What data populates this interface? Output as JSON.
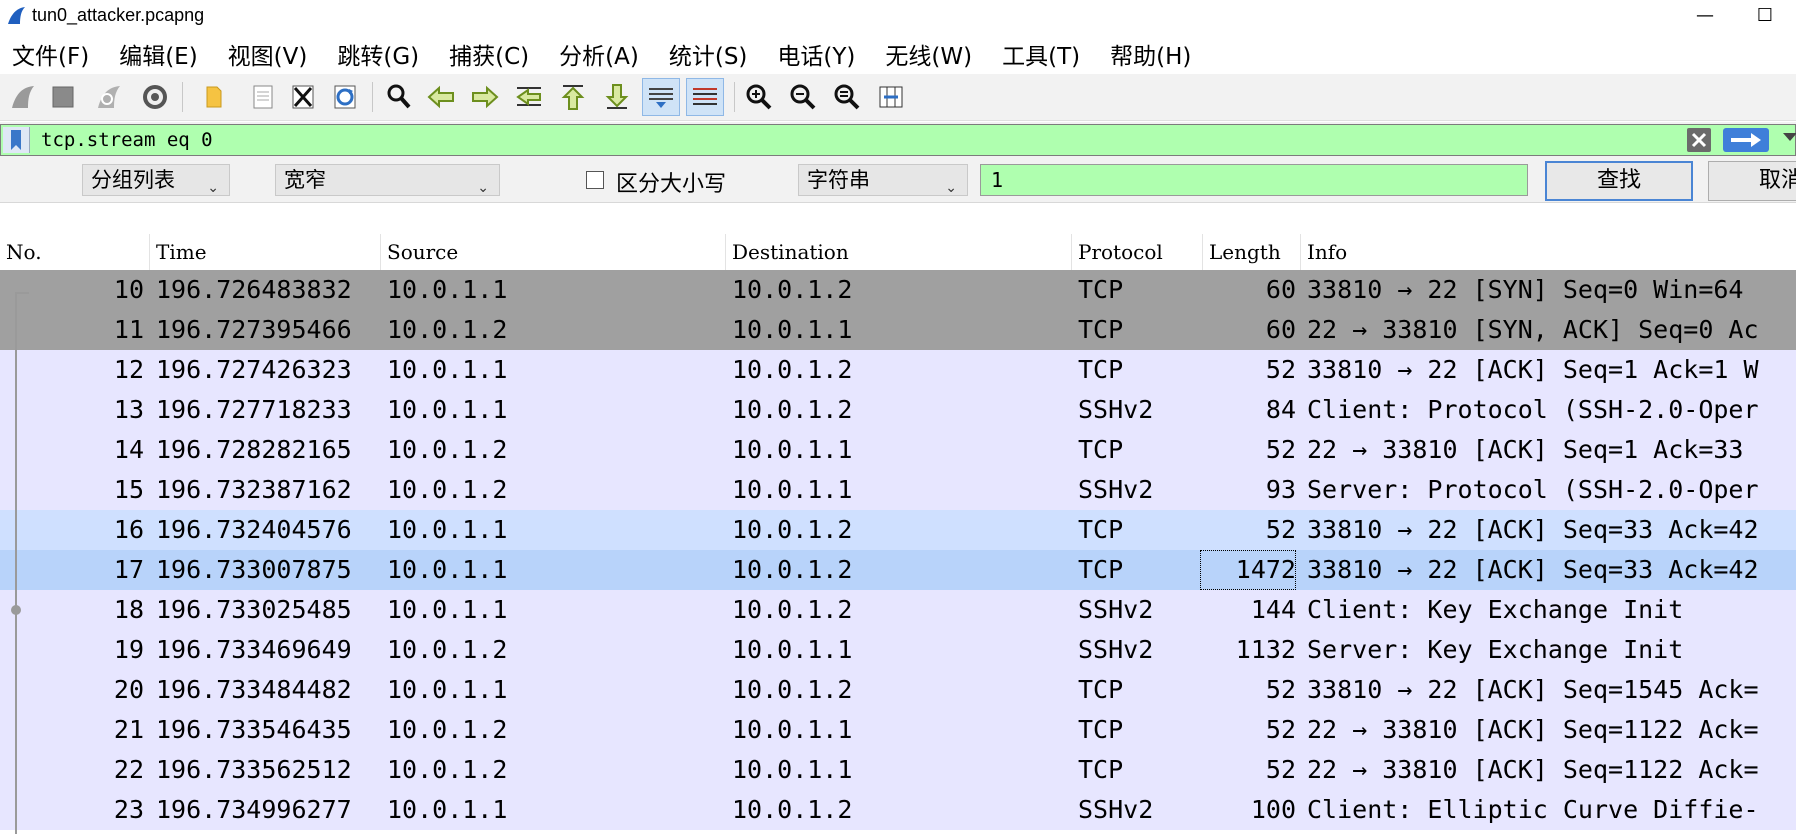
{
  "window": {
    "title": "tun0_attacker.pcapng",
    "minimize_glyph": "—",
    "maximize_glyph": "☐"
  },
  "menu": [
    "文件(F)",
    "编辑(E)",
    "视图(V)",
    "跳转(G)",
    "捕获(C)",
    "分析(A)",
    "统计(S)",
    "电话(Y)",
    "无线(W)",
    "工具(T)",
    "帮助(H)"
  ],
  "toolbar": {
    "icons": [
      "start-capture-icon",
      "stop-capture-icon",
      "restart-capture-icon",
      "capture-options-icon",
      "open-file-icon",
      "save-file-icon",
      "close-file-icon",
      "reload-file-icon",
      "find-packet-icon",
      "go-back-icon",
      "go-forward-icon",
      "go-to-packet-icon",
      "go-first-icon",
      "go-last-icon",
      "auto-scroll-icon",
      "colorize-icon",
      "zoom-in-icon",
      "zoom-out-icon",
      "zoom-normal-icon",
      "resize-columns-icon"
    ],
    "active": [
      "auto-scroll-icon",
      "colorize-icon"
    ]
  },
  "filter": {
    "value": "tcp.stream eq 0",
    "bg_color": "#afffaf"
  },
  "find": {
    "search_in": "分组列表",
    "char_width": "宽窄",
    "case_sensitive_label": "区分大小写",
    "search_type": "字符串",
    "search_value": "1",
    "find_label": "查找",
    "cancel_label": "取消"
  },
  "columns": [
    "No.",
    "Time",
    "Source",
    "Destination",
    "Protocol",
    "Length",
    "Info"
  ],
  "colors": {
    "dark_row": "#a0a0a0",
    "light_row": "#e7e6ff",
    "hover_row": "#cfe0ff",
    "selected_row": "#b8d3fa"
  },
  "packets": [
    {
      "no": "10",
      "time": "196.726483832",
      "src": "10.0.1.1",
      "dst": "10.0.1.2",
      "proto": "TCP",
      "len": "60",
      "info": "33810 → 22 [SYN] Seq=0 Win=64",
      "style": "dark_row"
    },
    {
      "no": "11",
      "time": "196.727395466",
      "src": "10.0.1.2",
      "dst": "10.0.1.1",
      "proto": "TCP",
      "len": "60",
      "info": "22 → 33810 [SYN, ACK] Seq=0 Ac",
      "style": "dark_row"
    },
    {
      "no": "12",
      "time": "196.727426323",
      "src": "10.0.1.1",
      "dst": "10.0.1.2",
      "proto": "TCP",
      "len": "52",
      "info": "33810 → 22 [ACK] Seq=1 Ack=1 W",
      "style": "light_row"
    },
    {
      "no": "13",
      "time": "196.727718233",
      "src": "10.0.1.1",
      "dst": "10.0.1.2",
      "proto": "SSHv2",
      "len": "84",
      "info": "Client: Protocol (SSH-2.0-Oper",
      "style": "light_row"
    },
    {
      "no": "14",
      "time": "196.728282165",
      "src": "10.0.1.2",
      "dst": "10.0.1.1",
      "proto": "TCP",
      "len": "52",
      "info": "22 → 33810 [ACK] Seq=1 Ack=33",
      "style": "light_row"
    },
    {
      "no": "15",
      "time": "196.732387162",
      "src": "10.0.1.2",
      "dst": "10.0.1.1",
      "proto": "SSHv2",
      "len": "93",
      "info": "Server: Protocol (SSH-2.0-Oper",
      "style": "light_row"
    },
    {
      "no": "16",
      "time": "196.732404576",
      "src": "10.0.1.1",
      "dst": "10.0.1.2",
      "proto": "TCP",
      "len": "52",
      "info": "33810 → 22 [ACK] Seq=33 Ack=42",
      "style": "hover_row"
    },
    {
      "no": "17",
      "time": "196.733007875",
      "src": "10.0.1.1",
      "dst": "10.0.1.2",
      "proto": "TCP",
      "len": "1472",
      "info": "33810 → 22 [ACK] Seq=33 Ack=42",
      "style": "selected_row"
    },
    {
      "no": "18",
      "time": "196.733025485",
      "src": "10.0.1.1",
      "dst": "10.0.1.2",
      "proto": "SSHv2",
      "len": "144",
      "info": "Client: Key Exchange Init",
      "style": "light_row"
    },
    {
      "no": "19",
      "time": "196.733469649",
      "src": "10.0.1.2",
      "dst": "10.0.1.1",
      "proto": "SSHv2",
      "len": "1132",
      "info": "Server: Key Exchange Init",
      "style": "light_row"
    },
    {
      "no": "20",
      "time": "196.733484482",
      "src": "10.0.1.1",
      "dst": "10.0.1.2",
      "proto": "TCP",
      "len": "52",
      "info": "33810 → 22 [ACK] Seq=1545 Ack=",
      "style": "light_row"
    },
    {
      "no": "21",
      "time": "196.733546435",
      "src": "10.0.1.2",
      "dst": "10.0.1.1",
      "proto": "TCP",
      "len": "52",
      "info": "22 → 33810 [ACK] Seq=1122 Ack=",
      "style": "light_row"
    },
    {
      "no": "22",
      "time": "196.733562512",
      "src": "10.0.1.2",
      "dst": "10.0.1.1",
      "proto": "TCP",
      "len": "52",
      "info": "22 → 33810 [ACK] Seq=1122 Ack=",
      "style": "light_row"
    },
    {
      "no": "23",
      "time": "196.734996277",
      "src": "10.0.1.1",
      "dst": "10.0.1.2",
      "proto": "SSHv2",
      "len": "100",
      "info": "Client: Elliptic Curve Diffie-",
      "style": "light_row"
    }
  ]
}
